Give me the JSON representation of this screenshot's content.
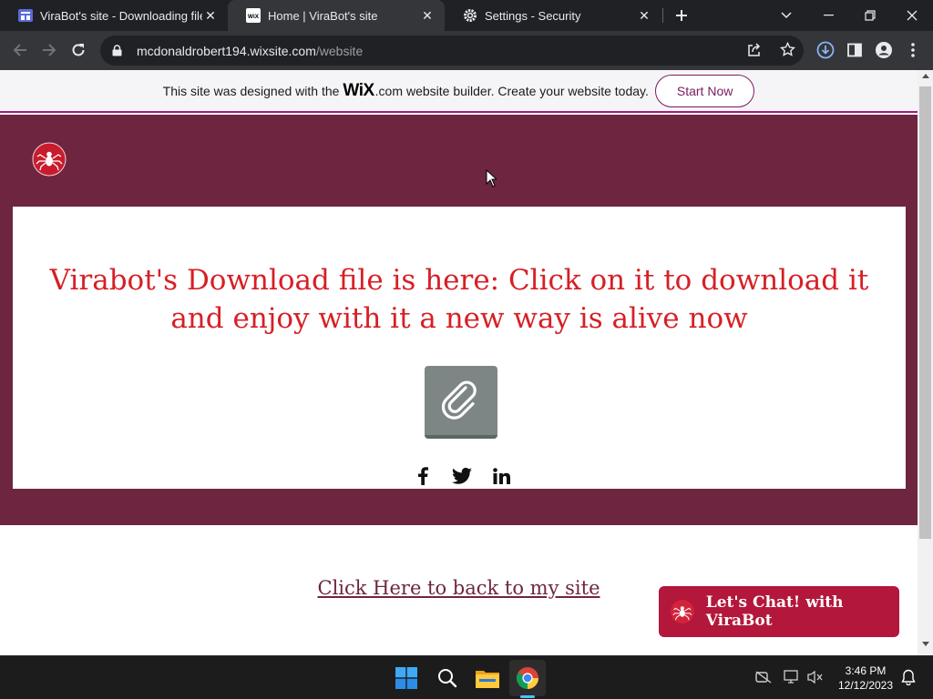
{
  "browser": {
    "tabs": [
      {
        "title": "ViraBot's site - Downloading file",
        "favicon": "wix-site-favicon",
        "active": false
      },
      {
        "title": "Home | ViraBot's site",
        "favicon": "wix-favicon",
        "active": true
      },
      {
        "title": "Settings - Security",
        "favicon": "gear-icon",
        "active": false
      }
    ],
    "url_host": "mcdonaldrobert194.wixsite.com",
    "url_path": "/website"
  },
  "wix_banner": {
    "prefix": "This site was designed with the",
    "logo": "WiX",
    "suffix": ".com",
    "rest": "website builder. Create your website today.",
    "cta": "Start Now"
  },
  "page": {
    "headline": "Virabot's Download file is here: Click on it to download it and enjoy with it a new way is alive now",
    "back_link": "Click Here to back to my site",
    "chat_label": "Let's Chat! with ViraBot"
  },
  "taskbar": {
    "time": "3:46 PM",
    "date": "12/12/2023"
  },
  "colors": {
    "hero_bg": "#6e2540",
    "headline": "#d71f26",
    "chat_bg": "#b3173b"
  }
}
